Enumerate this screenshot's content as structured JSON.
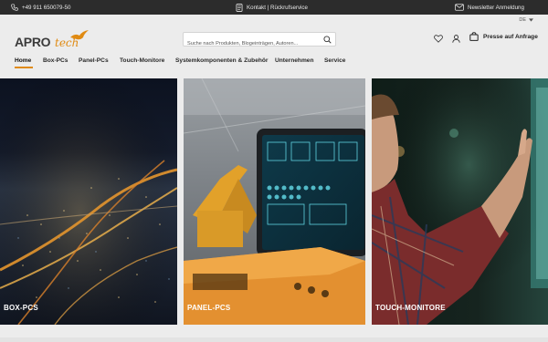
{
  "topbar": {
    "phone": "+49 911 650079-50",
    "contact": "Kontakt | Rückrufservice",
    "newsletter": "Newsletter Anmeldung"
  },
  "header": {
    "language": "DE",
    "logo": {
      "part1": "APRO",
      "part2": "tech"
    },
    "search_placeholder": "Suche nach Produkten, Blogeinträgen, Autoren...",
    "presse_label": "Presse auf Anfrage"
  },
  "nav": {
    "items": [
      {
        "label": "Home"
      },
      {
        "label": "Box-PCs"
      },
      {
        "label": "Panel-PCs"
      },
      {
        "label": "Touch-Monitore"
      },
      {
        "label": "Systemkomponenten & Zubehör"
      },
      {
        "label": "Unternehmen"
      },
      {
        "label": "Service"
      }
    ]
  },
  "tiles": [
    {
      "label": "BOX-PCS"
    },
    {
      "label": "PANEL-PCS"
    },
    {
      "label": "TOUCH-MONITORE"
    }
  ],
  "colors": {
    "accent": "#e08a12",
    "topbar": "#2c2c2c",
    "background": "#ececec"
  }
}
